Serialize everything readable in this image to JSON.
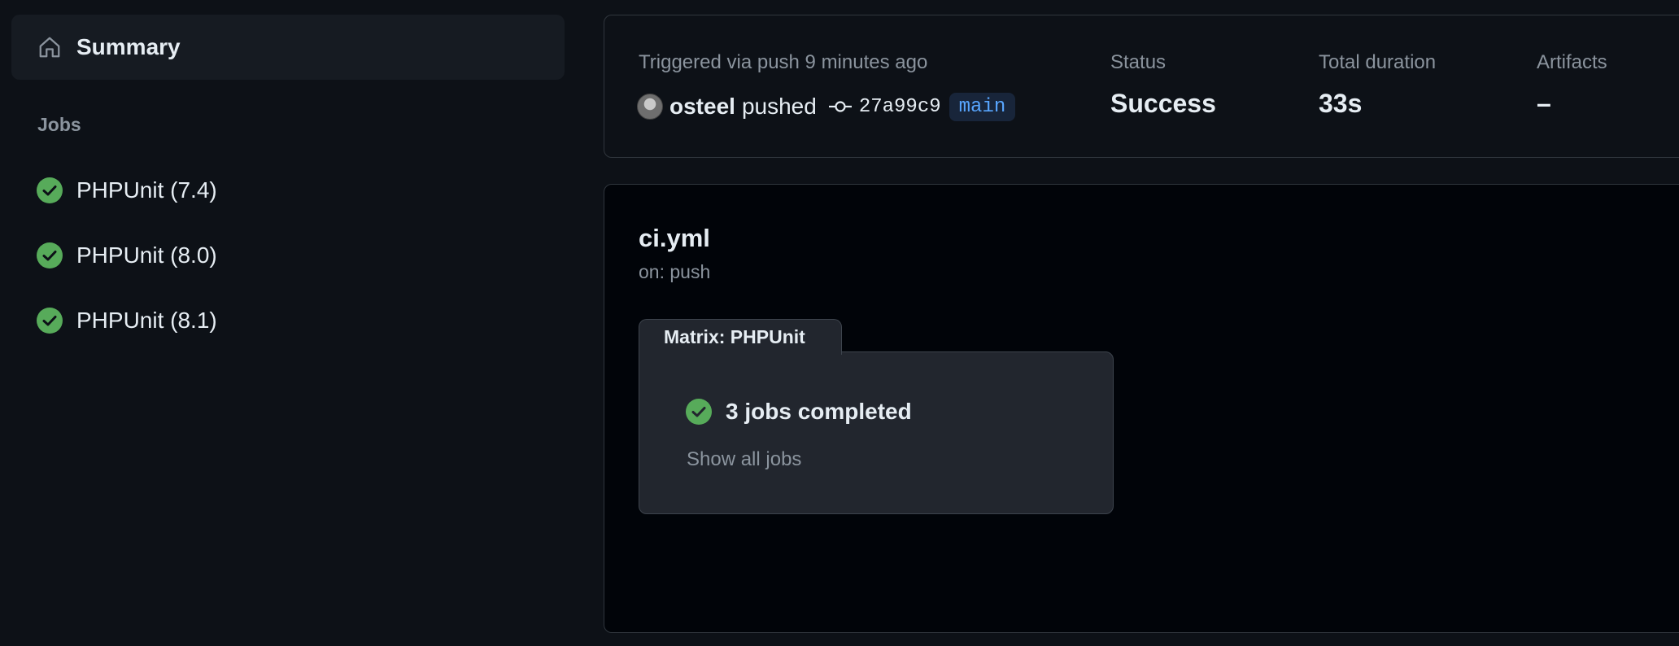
{
  "sidebar": {
    "summary_label": "Summary",
    "jobs_heading": "Jobs",
    "jobs": [
      {
        "label": "PHPUnit (7.4)",
        "status": "success"
      },
      {
        "label": "PHPUnit (8.0)",
        "status": "success"
      },
      {
        "label": "PHPUnit (8.1)",
        "status": "success"
      }
    ]
  },
  "run_summary": {
    "trigger_text": "Triggered via push 9 minutes ago",
    "actor": "osteel",
    "action": "pushed",
    "commit_sha": "27a99c9",
    "branch": "main",
    "status_label": "Status",
    "status_value": "Success",
    "duration_label": "Total duration",
    "duration_value": "33s",
    "artifacts_label": "Artifacts",
    "artifacts_value": "–"
  },
  "workflow": {
    "file_name": "ci.yml",
    "trigger": "on: push",
    "matrix_label": "Matrix: PHPUnit",
    "completed_text": "3 jobs completed",
    "show_all_label": "Show all jobs"
  },
  "colors": {
    "success": "#57ab5a",
    "background": "#0d1117",
    "panel_border": "#30363d",
    "branch_text": "#58a6ff",
    "muted_text": "#8b949e"
  },
  "icons": {
    "summary": "home-icon",
    "job_status": "check-circle-icon",
    "commit": "git-commit-icon"
  }
}
